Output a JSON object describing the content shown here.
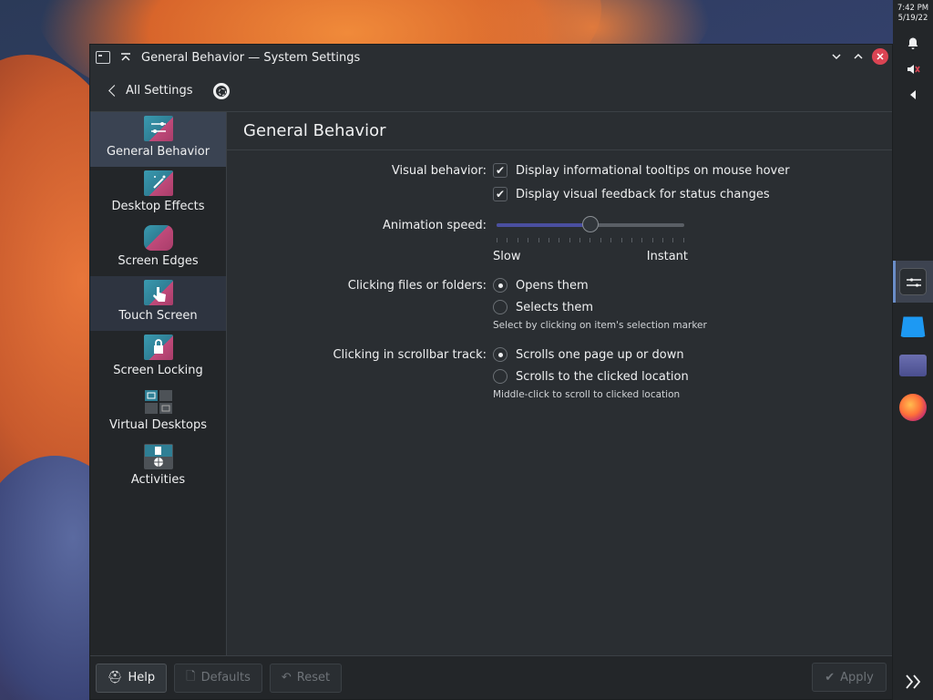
{
  "window": {
    "title": "General Behavior — System Settings"
  },
  "toolbar": {
    "back_label": "All Settings"
  },
  "sidebar": {
    "items": [
      {
        "label": "General Behavior"
      },
      {
        "label": "Desktop Effects"
      },
      {
        "label": "Screen Edges"
      },
      {
        "label": "Touch Screen"
      },
      {
        "label": "Screen Locking"
      },
      {
        "label": "Virtual Desktops"
      },
      {
        "label": "Activities"
      }
    ]
  },
  "page": {
    "title": "General Behavior",
    "visual_behavior": {
      "label": "Visual behavior:",
      "tooltips": {
        "label": "Display informational tooltips on mouse hover",
        "checked": true
      },
      "feedback": {
        "label": "Display visual feedback for status changes",
        "checked": true
      }
    },
    "animation_speed": {
      "label": "Animation speed:",
      "min_label": "Slow",
      "max_label": "Instant",
      "value": 0.5,
      "tick_count": 19
    },
    "clicking_files": {
      "label": "Clicking files or folders:",
      "options": [
        {
          "label": "Opens them",
          "selected": true
        },
        {
          "label": "Selects them",
          "selected": false
        }
      ],
      "hint": "Select by clicking on item's selection marker"
    },
    "scrollbar_track": {
      "label": "Clicking in scrollbar track:",
      "options": [
        {
          "label": "Scrolls one page up or down",
          "selected": true
        },
        {
          "label": "Scrolls to the clicked location",
          "selected": false
        }
      ],
      "hint": "Middle-click to scroll to clicked location"
    }
  },
  "footer": {
    "help_label": "Help",
    "defaults_label": "Defaults",
    "reset_label": "Reset",
    "apply_label": "Apply"
  },
  "panel": {
    "time": "7:42 PM",
    "date": "5/19/22"
  },
  "colors": {
    "accent": "#3daee9",
    "close": "#da4453",
    "window_bg": "#2a2e32",
    "sidebar_bg": "#232629"
  }
}
